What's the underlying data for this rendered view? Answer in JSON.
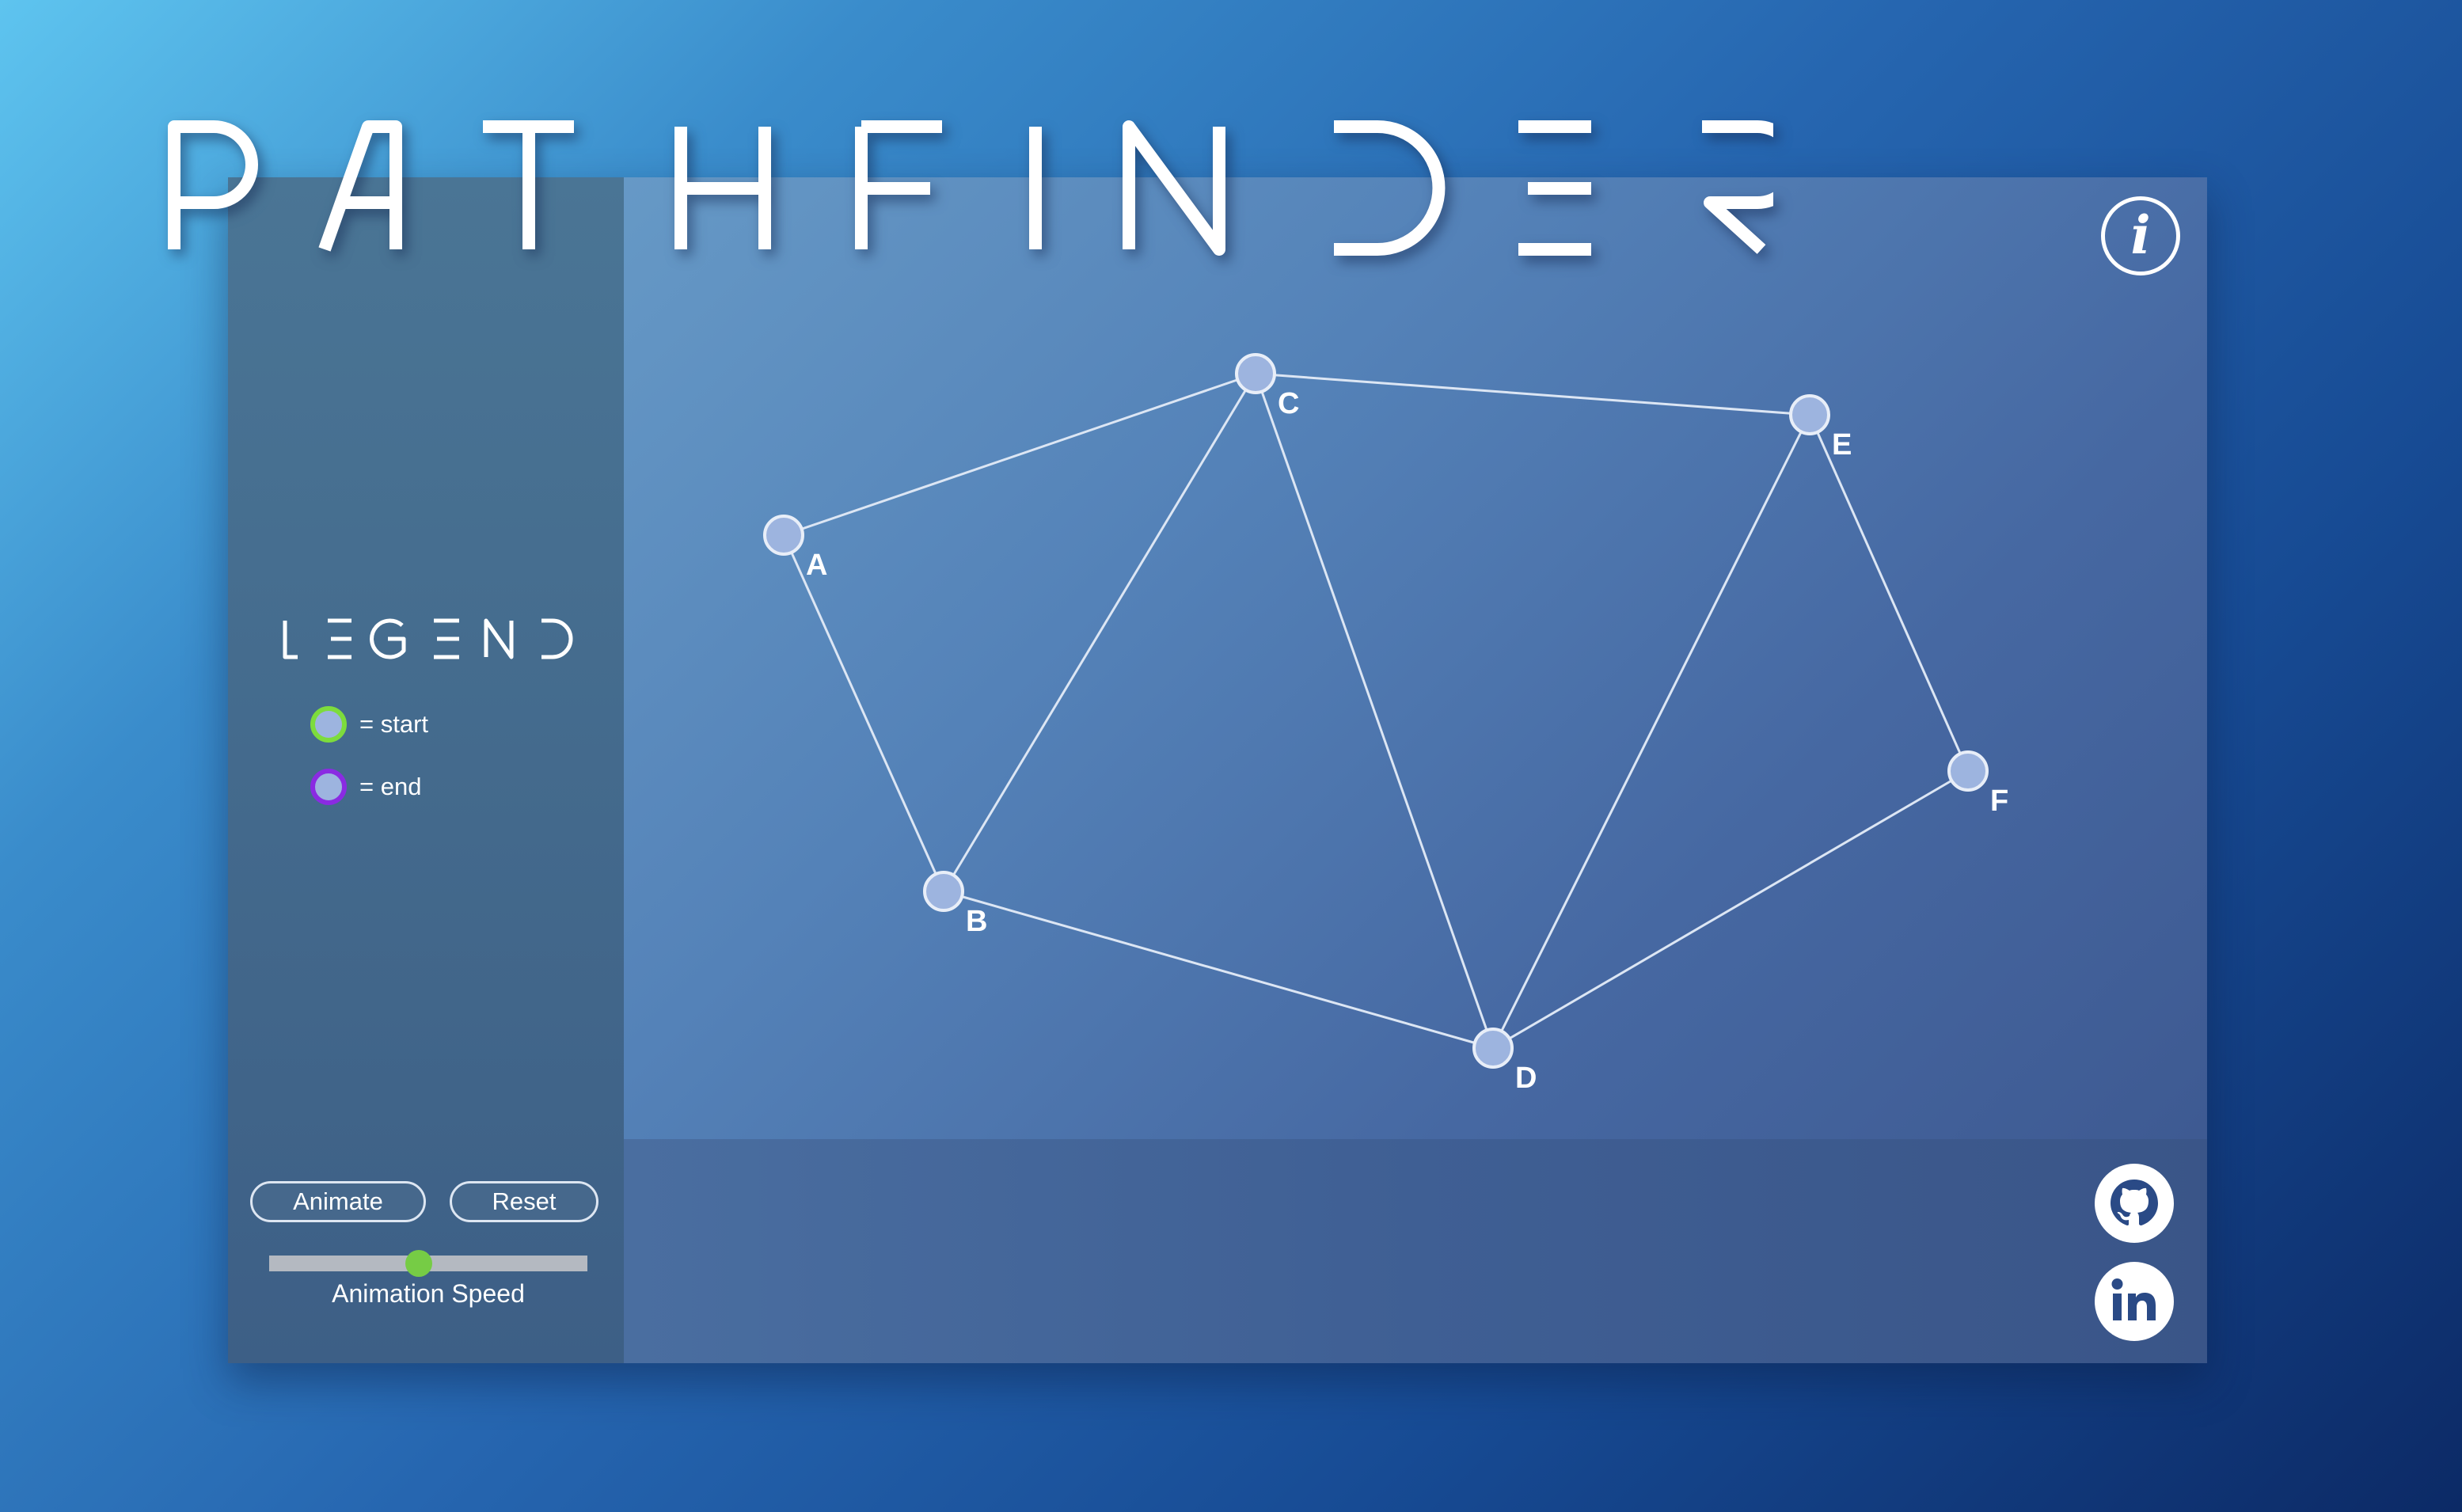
{
  "app": {
    "title": "PATHFINDER",
    "info_icon": "info-icon",
    "info_glyph": "i"
  },
  "legend": {
    "heading": "LEGEND",
    "items": [
      {
        "label": "= start",
        "ring_color": "#7ddc3c"
      },
      {
        "label": "= end",
        "ring_color": "#8a2be2"
      }
    ]
  },
  "controls": {
    "animate_label": "Animate",
    "reset_label": "Reset",
    "speed_label": "Animation Speed",
    "speed_value": 0.47
  },
  "graph": {
    "nodes": [
      {
        "id": "A",
        "label": "A"
      },
      {
        "id": "B",
        "label": "B"
      },
      {
        "id": "C",
        "label": "C"
      },
      {
        "id": "D",
        "label": "D"
      },
      {
        "id": "E",
        "label": "E"
      },
      {
        "id": "F",
        "label": "F"
      }
    ],
    "edges": [
      [
        "A",
        "C"
      ],
      [
        "A",
        "B"
      ],
      [
        "B",
        "C"
      ],
      [
        "B",
        "D"
      ],
      [
        "C",
        "D"
      ],
      [
        "C",
        "E"
      ],
      [
        "E",
        "D"
      ],
      [
        "E",
        "F"
      ],
      [
        "F",
        "D"
      ]
    ],
    "node_fill": "#9db4df",
    "edge_color": "#dce6f4"
  },
  "social": {
    "github_icon": "github-icon",
    "linkedin_icon": "linkedin-icon"
  },
  "colors": {
    "accent_green": "#76cc45",
    "panel_text": "#ffffff"
  }
}
